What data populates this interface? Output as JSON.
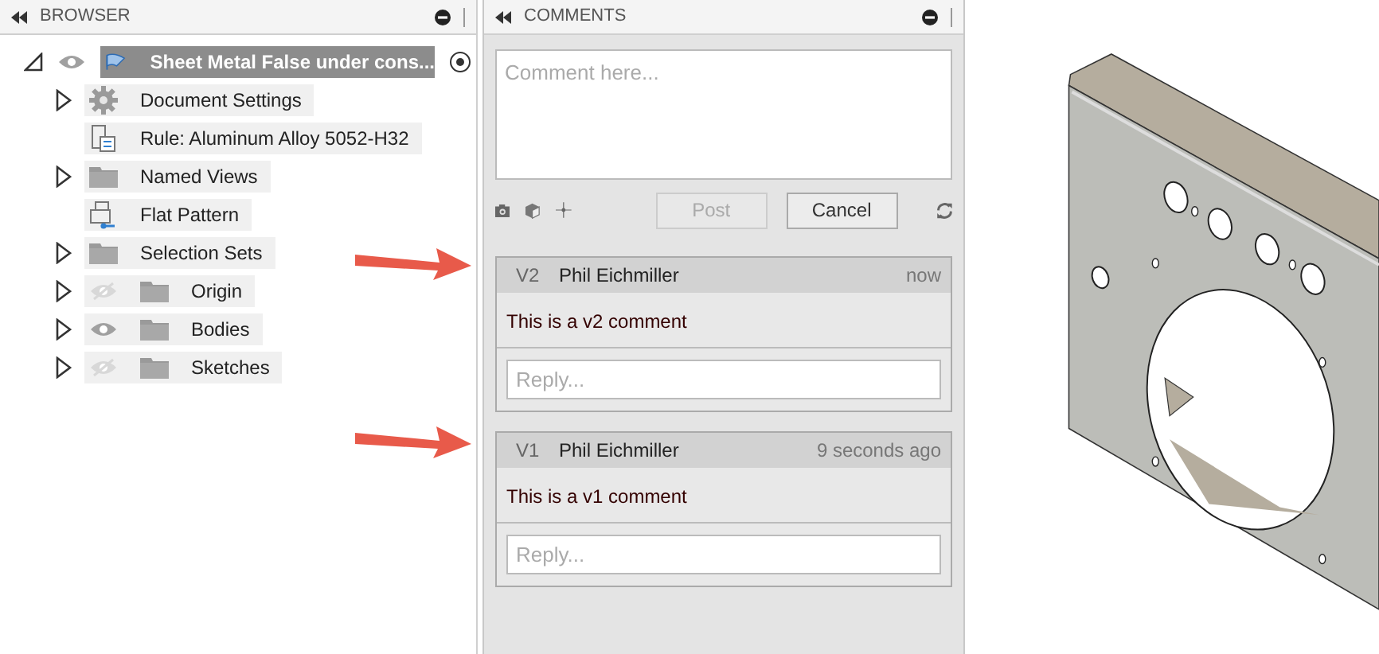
{
  "browser": {
    "title": "BROWSER",
    "root": {
      "label": "Sheet Metal False under cons...",
      "expanded": true,
      "visible": true,
      "active": true,
      "children": [
        {
          "label": "Document Settings",
          "kind": "gear",
          "expanded": false
        },
        {
          "label": "Rule: Aluminum Alloy 5052-H32",
          "kind": "rule"
        },
        {
          "label": "Named Views",
          "kind": "folder",
          "expanded": false
        },
        {
          "label": "Flat Pattern",
          "kind": "flat"
        },
        {
          "label": "Selection Sets",
          "kind": "folder",
          "expanded": false
        },
        {
          "label": "Origin",
          "kind": "folder",
          "expanded": false,
          "visible": false
        },
        {
          "label": "Bodies",
          "kind": "folder",
          "expanded": false,
          "visible": true
        },
        {
          "label": "Sketches",
          "kind": "folder",
          "expanded": false,
          "visible": false
        }
      ]
    }
  },
  "comments": {
    "title": "COMMENTS",
    "input": {
      "placeholder": "Comment here..."
    },
    "post_button": {
      "label": "Post",
      "disabled": true
    },
    "cancel_button": {
      "label": "Cancel",
      "disabled": false
    },
    "items": [
      {
        "version": "V2",
        "author": "Phil Eichmiller",
        "time": "now",
        "text": "This is a v2 comment",
        "reply_placeholder": "Reply..."
      },
      {
        "version": "V1",
        "author": "Phil Eichmiller",
        "time": "9 seconds ago",
        "text": "This is a v1 comment",
        "reply_placeholder": "Reply..."
      }
    ]
  }
}
